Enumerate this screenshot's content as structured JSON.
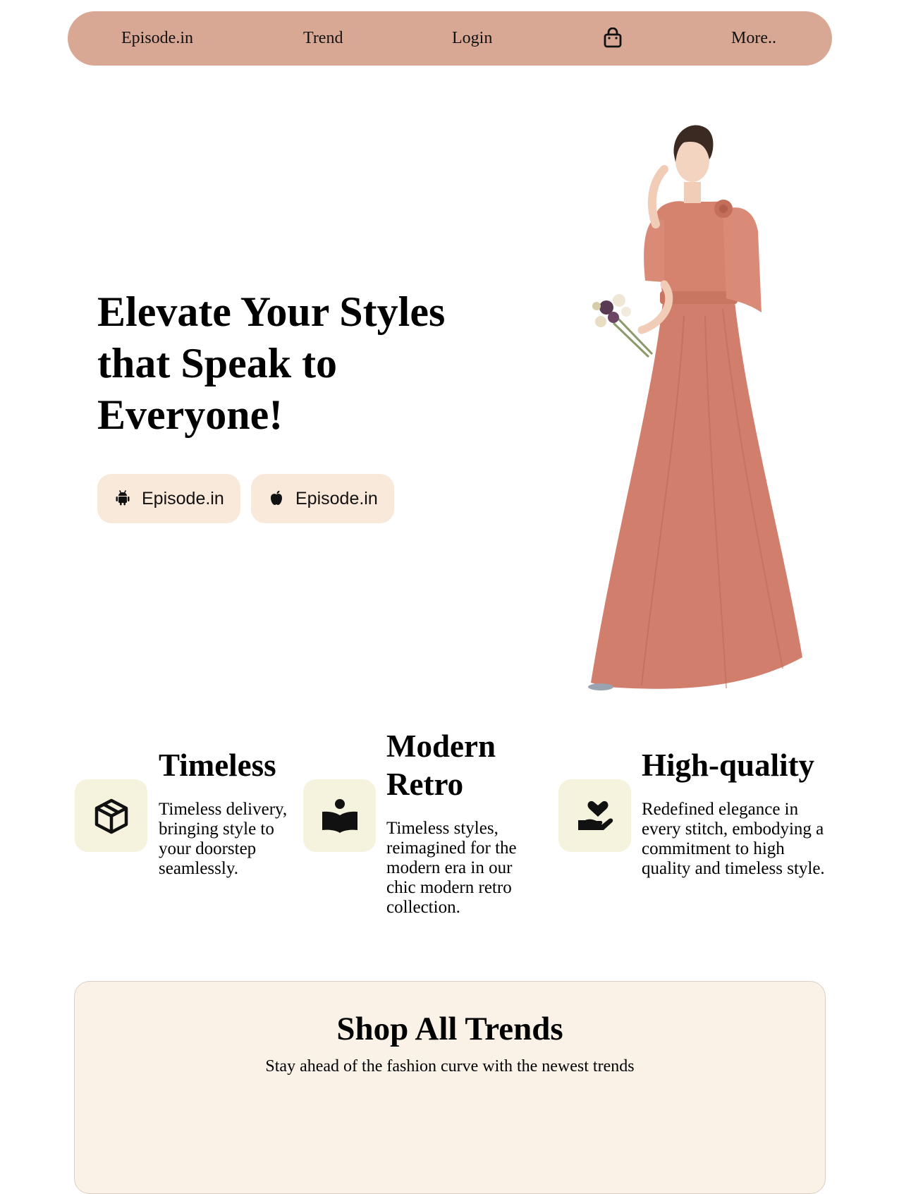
{
  "nav": {
    "brand": "Episode.in",
    "trend": "Trend",
    "login": "Login",
    "bag_icon": "shopping-bag-icon",
    "more": "More.."
  },
  "hero": {
    "title": "Elevate Your Styles that Speak to Everyone!",
    "buttons": [
      {
        "icon": "android-icon",
        "label": "Episode.in"
      },
      {
        "icon": "apple-icon",
        "label": "Episode.in"
      }
    ],
    "image": "model in coral floor-length dress holding a bouquet"
  },
  "features": [
    {
      "icon": "package-box-icon",
      "title": "Timeless",
      "description": "Timeless delivery, bringing style to your doorstep seamlessly."
    },
    {
      "icon": "reader-book-icon",
      "title": "Modern Retro",
      "description": "Timeless styles, reimagined for the modern era in our chic modern retro collection."
    },
    {
      "icon": "heart-hand-icon",
      "title": "High-quality",
      "description": "Redefined elegance in every stitch, embodying a commitment to high quality and timeless style."
    }
  ],
  "shop": {
    "title": "Shop All Trends",
    "subtitle": "Stay ahead of the fashion curve with the newest trends"
  },
  "colors": {
    "navbar": "#d9a895",
    "store_button": "#f9e9da",
    "feature_icon_bg": "#f5f3dd",
    "shop_section_bg": "#faf1e7",
    "dress": "#d17e6c"
  }
}
